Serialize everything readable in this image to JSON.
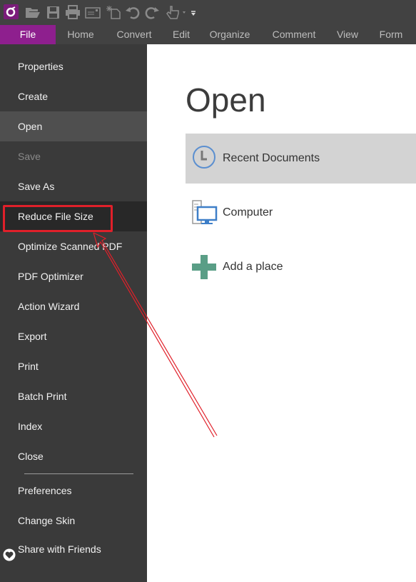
{
  "quick_access": [
    {
      "name": "app-logo-icon"
    },
    {
      "name": "open-folder-icon"
    },
    {
      "name": "save-icon"
    },
    {
      "name": "print-icon"
    },
    {
      "name": "email-icon"
    },
    {
      "name": "new-document-icon"
    },
    {
      "name": "undo-icon"
    },
    {
      "name": "redo-icon"
    },
    {
      "name": "hand-tool-icon"
    },
    {
      "name": "customize-toolbar-icon"
    }
  ],
  "ribbon_tabs": [
    {
      "label": "File"
    },
    {
      "label": "Home"
    },
    {
      "label": "Convert"
    },
    {
      "label": "Edit"
    },
    {
      "label": "Organize"
    },
    {
      "label": "Comment"
    },
    {
      "label": "View"
    },
    {
      "label": "Form"
    }
  ],
  "sidebar": {
    "items": [
      {
        "label": "Properties"
      },
      {
        "label": "Create"
      },
      {
        "label": "Open",
        "state": "selected"
      },
      {
        "label": "Save",
        "state": "disabled"
      },
      {
        "label": "Save As"
      },
      {
        "label": "Reduce File Size",
        "state": "highlighted"
      },
      {
        "label": "Optimize Scanned PDF"
      },
      {
        "label": "PDF Optimizer"
      },
      {
        "label": "Action Wizard"
      },
      {
        "label": "Export"
      },
      {
        "label": "Print"
      },
      {
        "label": "Batch Print"
      },
      {
        "label": "Index"
      },
      {
        "label": "Close"
      }
    ],
    "bottom_items": [
      {
        "label": "Preferences"
      },
      {
        "label": "Change Skin"
      },
      {
        "label": "Share with Friends",
        "icon": "heart-icon"
      }
    ]
  },
  "main": {
    "title": "Open",
    "places": [
      {
        "label": "Recent Documents",
        "icon": "clock-icon",
        "active": true
      },
      {
        "label": "Computer",
        "icon": "computer-icon"
      },
      {
        "label": "Add a place",
        "icon": "plus-icon"
      }
    ]
  },
  "annotation": {
    "color": "#e0202a",
    "target": "Reduce File Size"
  },
  "colors": {
    "accent": "#8e1f8e",
    "sidebar": "#3a3a3a",
    "topbar": "#424242"
  }
}
